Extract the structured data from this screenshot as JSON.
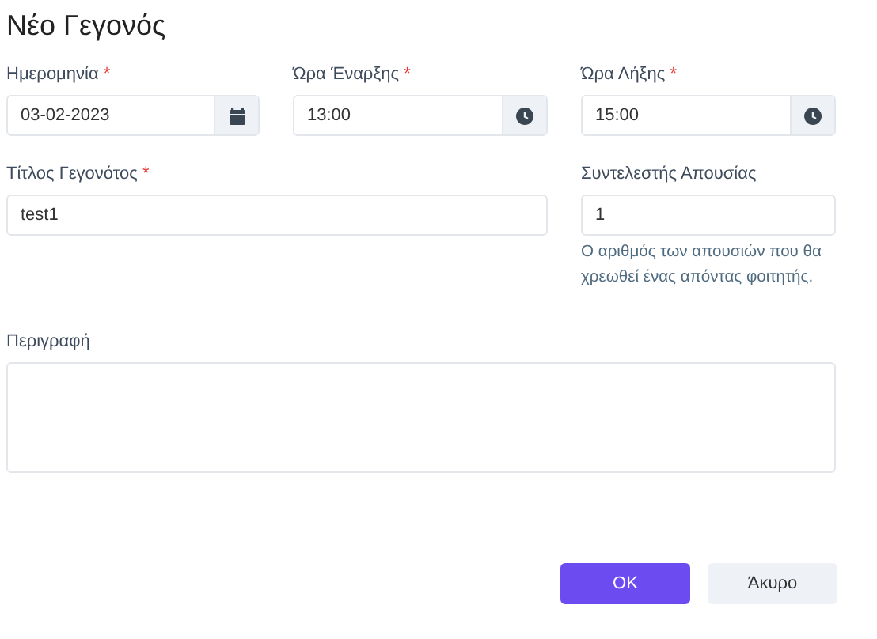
{
  "title": "Νέο Γεγονός",
  "required_mark": "*",
  "rows": [
    {
      "fields": [
        {
          "kind": "date",
          "label": "Ημερομηνία",
          "required": true,
          "value": "03-02-2023"
        },
        {
          "kind": "time",
          "label": "Ώρα Έναρξης",
          "required": true,
          "value": "13:00"
        },
        {
          "kind": "time",
          "label": "Ώρα Λήξης",
          "required": true,
          "value": "15:00"
        }
      ]
    },
    {
      "fields": [
        {
          "kind": "text",
          "label": "Τίτλος Γεγονότος",
          "required": true,
          "value": "test1"
        },
        {
          "kind": "text",
          "label": "Συντελεστής Απουσίας",
          "required": false,
          "value": "1",
          "help": "Ο αριθμός των απουσιών που θα χρεωθεί ένας απόντας φοιτητής."
        }
      ]
    },
    {
      "fields": [
        {
          "kind": "textarea",
          "label": "Περιγραφή",
          "required": false
        }
      ]
    }
  ],
  "buttons": [
    {
      "kind": "primary",
      "label": "OK"
    },
    {
      "kind": "secondary",
      "label": "Άκυρο"
    }
  ]
}
